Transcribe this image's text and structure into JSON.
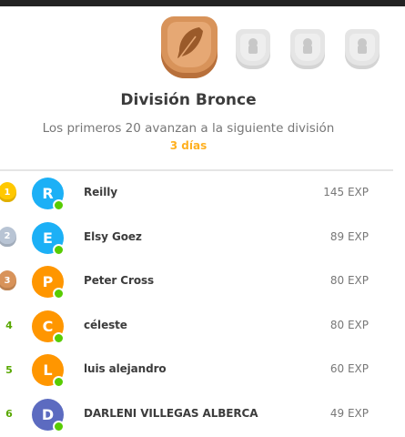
{
  "league": {
    "title": "División Bronce",
    "subtitle": "Los primeros 20 avanzan a la siguiente división",
    "time_left": "3 días",
    "badges": [
      {
        "name": "bronze-league-badge",
        "state": "active",
        "color": "#d8935a"
      },
      {
        "name": "locked-league-badge",
        "state": "locked"
      },
      {
        "name": "locked-league-badge",
        "state": "locked"
      },
      {
        "name": "locked-league-badge",
        "state": "locked"
      }
    ]
  },
  "colors": {
    "accent_green": "#58cc02",
    "time_color": "#ffb020",
    "gold": "#ffc800",
    "silver": "#b8c4d4",
    "bronze": "#d8935a"
  },
  "leaderboard": [
    {
      "rank": "1",
      "medal": "gold",
      "initial": "R",
      "avatar_color": "#1cb0f6",
      "name": "Reilly",
      "xp": "145 EXP"
    },
    {
      "rank": "2",
      "medal": "silver",
      "initial": "E",
      "avatar_color": "#1cb0f6",
      "name": "Elsy Goez",
      "xp": "89 EXP"
    },
    {
      "rank": "3",
      "medal": "bronze",
      "initial": "P",
      "avatar_color": "#ff9600",
      "name": "Peter Cross",
      "xp": "80 EXP"
    },
    {
      "rank": "4",
      "medal": null,
      "initial": "C",
      "avatar_color": "#ff9600",
      "name": "céleste",
      "xp": "80 EXP"
    },
    {
      "rank": "5",
      "medal": null,
      "initial": "L",
      "avatar_color": "#ff9600",
      "name": "luis alejandro",
      "xp": "60 EXP"
    },
    {
      "rank": "6",
      "medal": null,
      "initial": "D",
      "avatar_color": "#5c6bc0",
      "name": "DARLENI VILLEGAS ALBERCA",
      "xp": "49 EXP"
    }
  ]
}
